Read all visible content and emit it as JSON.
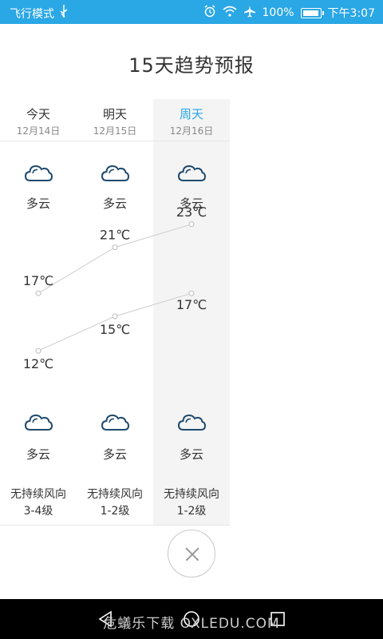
{
  "status_bar": {
    "airplane_mode_label": "飞行模式",
    "usb_icon": "usb-icon",
    "alarm_icon": "alarm-icon",
    "wifi_icon": "wifi-icon",
    "airplane_icon": "airplane-icon",
    "battery_percent_label": "100%",
    "battery_level": 1.0,
    "time": "下午3:07"
  },
  "title": "15天趋势预报",
  "days": [
    {
      "name": "今天",
      "date": "12月14日",
      "day_condition": "多云",
      "night_condition": "多云",
      "wind_direction": "无持续风向",
      "wind_level": "3-4级",
      "high": "17℃",
      "low": "12℃",
      "selected": false
    },
    {
      "name": "明天",
      "date": "12月15日",
      "day_condition": "多云",
      "night_condition": "多云",
      "wind_direction": "无持续风向",
      "wind_level": "1-2级",
      "high": "21℃",
      "low": "15℃",
      "selected": false
    },
    {
      "name": "周天",
      "date": "12月16日",
      "day_condition": "多云",
      "night_condition": "多云",
      "wind_direction": "无持续风向",
      "wind_level": "1-2级",
      "high": "23℃",
      "low": "17℃",
      "selected": true
    }
  ],
  "chart_data": {
    "type": "line",
    "x": [
      "12月14日",
      "12月15日",
      "12月16日"
    ],
    "series": [
      {
        "values": [
          17,
          21,
          23
        ]
      },
      {
        "values": [
          12,
          15,
          17
        ]
      }
    ],
    "ylim": [
      10,
      25
    ],
    "grid": false
  },
  "colors": {
    "status_bar": "#2aa7e5",
    "selected_day": "#2aa7e5",
    "highlight_bg": "#f4f4f4",
    "line": "#cccccc",
    "icon_stroke": "#1f4a6e"
  },
  "close_button": {
    "icon": "close-icon"
  },
  "nav_bar": {
    "back_icon": "back-icon",
    "home_icon": "home-icon",
    "recent_icon": "recent-apps-icon"
  },
  "watermark": "危蟻乐下载 OXLEDU.COM"
}
